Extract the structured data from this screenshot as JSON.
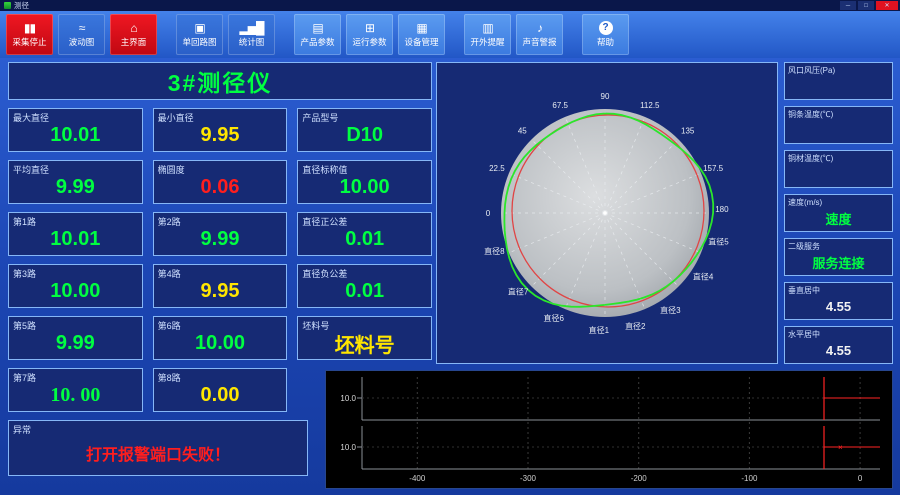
{
  "window": {
    "title": "测径",
    "minimize": "─",
    "maximize": "□",
    "close": "✕"
  },
  "colors": {
    "green": "#00ff41",
    "yellow": "#ffe600",
    "red": "#ff1e1e",
    "white": "#f2f2f2"
  },
  "toolbar": {
    "buttons": [
      {
        "label": "采集停止",
        "icon": "stop-icon",
        "glyph": "▮▮",
        "variant": "red"
      },
      {
        "label": "波动图",
        "icon": "wave-icon",
        "glyph": "≈",
        "variant": "normal"
      },
      {
        "label": "主界面",
        "icon": "home-icon",
        "glyph": "⌂",
        "variant": "red"
      },
      {
        "label": "单回路图",
        "icon": "loop-icon",
        "glyph": "▣",
        "variant": "normal",
        "gap": true
      },
      {
        "label": "统计图",
        "icon": "stats-icon",
        "glyph": "▂▅█",
        "variant": "normal"
      },
      {
        "label": "产品参数",
        "icon": "product-icon",
        "glyph": "▤",
        "variant": "light",
        "gap": true
      },
      {
        "label": "运行参数",
        "icon": "run-icon",
        "glyph": "⊞",
        "variant": "light"
      },
      {
        "label": "设备管理",
        "icon": "device-icon",
        "glyph": "▦",
        "variant": "light"
      },
      {
        "label": "开外提醒",
        "icon": "alert-icon",
        "glyph": "▥",
        "variant": "light",
        "gap": true
      },
      {
        "label": "声音警报",
        "icon": "sound-icon",
        "glyph": "♪",
        "variant": "light"
      },
      {
        "label": "帮助",
        "icon": "help-icon",
        "glyph": "?",
        "variant": "light",
        "gap": true
      }
    ]
  },
  "left": {
    "title": "3#测径仪",
    "cells": [
      {
        "label": "最大直径",
        "value": "10.01",
        "color": "green"
      },
      {
        "label": "最小直径",
        "value": "9.95",
        "color": "yellow"
      },
      {
        "label": "产品型号",
        "value": "D10",
        "color": "green"
      },
      {
        "label": "平均直径",
        "value": "9.99",
        "color": "green"
      },
      {
        "label": "椭圆度",
        "value": "0.06",
        "color": "red"
      },
      {
        "label": "直径标称值",
        "value": "10.00",
        "color": "green"
      },
      {
        "label": "第1路",
        "value": "10.01",
        "color": "green"
      },
      {
        "label": "第2路",
        "value": "9.99",
        "color": "green"
      },
      {
        "label": "直径正公差",
        "value": "0.01",
        "color": "green"
      },
      {
        "label": "第3路",
        "value": "10.00",
        "color": "green"
      },
      {
        "label": "第4路",
        "value": "9.95",
        "color": "yellow"
      },
      {
        "label": "直径负公差",
        "value": "0.01",
        "color": "green"
      },
      {
        "label": "第5路",
        "value": "9.99",
        "color": "green"
      },
      {
        "label": "第6路",
        "value": "10.00",
        "color": "green"
      },
      {
        "label": "坯料号",
        "value": "坯料号",
        "color": "yellow"
      },
      {
        "label": "第7路",
        "value": "10. 00",
        "color": "green",
        "serif": true
      },
      {
        "label": "第8路",
        "value": "0.00",
        "color": "yellow"
      }
    ],
    "alarm": {
      "label": "异常",
      "value": "打开报警端口失败！"
    }
  },
  "polar": {
    "labels": [
      {
        "text": "90",
        "deg": 90
      },
      {
        "text": "112.5",
        "deg": 67.5
      },
      {
        "text": "135",
        "deg": 45
      },
      {
        "text": "157.5",
        "deg": 22.5
      },
      {
        "text": "180",
        "deg": 2
      },
      {
        "text": "67.5",
        "deg": 112.5
      },
      {
        "text": "45",
        "deg": 135
      },
      {
        "text": "22.5",
        "deg": 157.5
      },
      {
        "text": "0",
        "deg": 180
      },
      {
        "text": "直径5",
        "deg": -14
      },
      {
        "text": "直径4",
        "deg": -33
      },
      {
        "text": "直径3",
        "deg": -56
      },
      {
        "text": "直径2",
        "deg": -75
      },
      {
        "text": "直径1",
        "deg": -93
      },
      {
        "text": "直径6",
        "deg": -116
      },
      {
        "text": "直径7",
        "deg": -138
      },
      {
        "text": "直径8",
        "deg": -161
      }
    ]
  },
  "right_panels": [
    {
      "label": "风口风压(Pa)",
      "value": "",
      "color": "white"
    },
    {
      "label": "铜条温度(℃)",
      "value": "",
      "color": "white"
    },
    {
      "label": "铜材温度(℃)",
      "value": "",
      "color": "white"
    },
    {
      "label": "速度(m/s)",
      "value": "速度",
      "color": "green"
    },
    {
      "label": "二级服务",
      "value": "服务连接",
      "color": "green"
    },
    {
      "label": "垂直居中",
      "value": "4.55",
      "color": "white"
    },
    {
      "label": "水平居中",
      "value": "4.55",
      "color": "white"
    }
  ],
  "trend": {
    "x_ticks": [
      "-400",
      "-300",
      "-200",
      "-100",
      "0"
    ],
    "y_labels": [
      "10.0",
      "10.0"
    ]
  },
  "chart_data": [
    {
      "type": "polar-profile",
      "description": "8-path diameter cross-section with gray body, red reference circle and green measured profile",
      "angle_labels": [
        "0",
        "22.5",
        "45",
        "67.5",
        "90",
        "112.5",
        "135",
        "157.5",
        "180"
      ],
      "path_labels": [
        "直径1",
        "直径2",
        "直径3",
        "直径4",
        "直径5",
        "直径6",
        "直径7",
        "直径8"
      ],
      "rings": [
        "body-gray",
        "reference-red",
        "measured-green"
      ]
    },
    {
      "type": "line",
      "x_ticks": [
        -400,
        -300,
        -200,
        -100,
        0
      ],
      "strips": [
        {
          "y_tick": "10.0"
        },
        {
          "y_tick": "10.0"
        }
      ],
      "note": "two stacked strip charts, red live marker near right edge"
    }
  ]
}
